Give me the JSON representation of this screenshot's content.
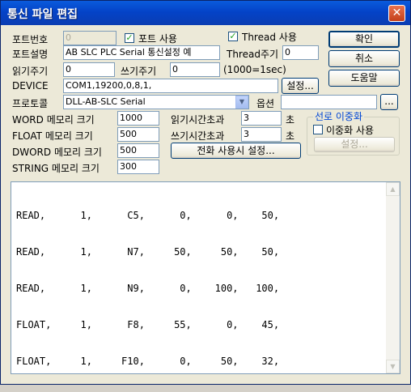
{
  "window": {
    "title": "통신 파일 편집",
    "close": "✕"
  },
  "row1": {
    "port_no_label": "포트번호",
    "port_no_value": "0",
    "port_use_label": "포트 사용",
    "port_use_checked": "✓",
    "thread_use_label": "Thread 사용",
    "thread_use_checked": "✓"
  },
  "row2": {
    "port_desc_label": "포트설명",
    "port_desc_value": "AB SLC PLC Serial 통신설정 예",
    "thread_cycle_label": "Thread주기",
    "thread_cycle_value": "0"
  },
  "row3": {
    "read_cycle_label": "읽기주기",
    "read_cycle_value": "0",
    "write_cycle_label": "쓰기주기",
    "write_cycle_value": "0",
    "unit_note": "(1000=1sec)"
  },
  "row4": {
    "device_label": "DEVICE",
    "device_value": "COM1,19200,0,8,1,",
    "settings_button": "설정..."
  },
  "row5": {
    "protocol_label": "프로토콜",
    "protocol_value": "DLL-AB-SLC Serial",
    "option_label": "옵션",
    "option_value": "",
    "browse_button": "..."
  },
  "memory": {
    "word_label": "WORD 메모리 크기",
    "word_value": "1000",
    "float_label": "FLOAT 메모리 크기",
    "float_value": "500",
    "dword_label": "DWORD 메모리 크기",
    "dword_value": "500",
    "string_label": "STRING 메모리 크기",
    "string_value": "300"
  },
  "timeouts": {
    "read_label": "읽기시간초과",
    "read_value": "3",
    "read_unit": "초",
    "write_label": "쓰기시간초과",
    "write_value": "3",
    "write_unit": "초",
    "phone_button": "전화 사용시 설정..."
  },
  "redundancy": {
    "group_title": "선로 이중화",
    "use_label": "이중화 사용",
    "settings_button": "설정..."
  },
  "buttons": {
    "ok": "확인",
    "cancel": "취소",
    "help": "도움말"
  },
  "editor": {
    "lines": [
      "READ,      1,      C5,      0,      0,    50,",
      "READ,      1,      N7,     50,     50,    50,",
      "READ,      1,      N9,      0,    100,   100,",
      "FLOAT,     1,      F8,     55,      0,    45,",
      "FLOAT,     1,     F10,      0,     50,    32,"
    ]
  }
}
